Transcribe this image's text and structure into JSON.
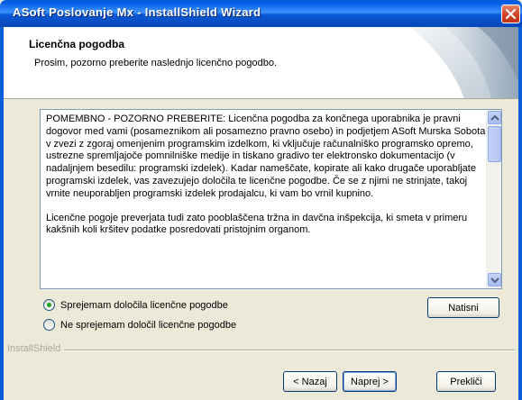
{
  "window": {
    "title": "ASoft Poslovanje Mx - InstallShield Wizard"
  },
  "header": {
    "title": "Licenčna pogodba",
    "subtitle": "Prosim, pozorno preberite naslednjo licenčno pogodbo."
  },
  "license": {
    "paragraph1": "POMEMBNO - POZORNO PREBERITE: Licenčna pogodba za končnega uporabnika je pravni dogovor med vami (posameznikom ali posamezno pravno osebo) in podjetjem ASoft Murska Sobota v zvezi z zgoraj omenjenim programskim izdelkom, ki vključuje računalniško programsko opremo, ustrezne spremljajoče pomnilniške medije in tiskano gradivo ter elektronsko dokumentacijo (v nadaljnjem besedilu: programski izdelek). Kadar nameščate, kopirate ali kako drugače uporabljate programski izdelek, vas zavezujejo določila te licenčne pogodbe. Če se z njimi ne strinjate, takoj vrnite neuporabljen programski izdelek prodajalcu, ki vam bo vrnil kupnino.",
    "paragraph2": "Licenčne pogoje preverjata tudi zato pooblaščena tržna in davčna inšpekcija, ki smeta  v primeru kakšnih koli kršitev podatke posredovati pristojnim organom."
  },
  "options": {
    "accept_label": "Sprejemam določila licenčne pogodbe",
    "decline_label": "Ne sprejemam določil licenčne pogodbe",
    "selected": "accept"
  },
  "buttons": {
    "print": "Natisni",
    "back": "< Nazaj",
    "next": "Naprej >",
    "cancel": "Prekliči"
  },
  "footer": {
    "brand": "InstallShield"
  },
  "colors": {
    "titlebar": "#0a5fd8",
    "background": "#ece9d8",
    "radio_selected": "#21a121"
  }
}
